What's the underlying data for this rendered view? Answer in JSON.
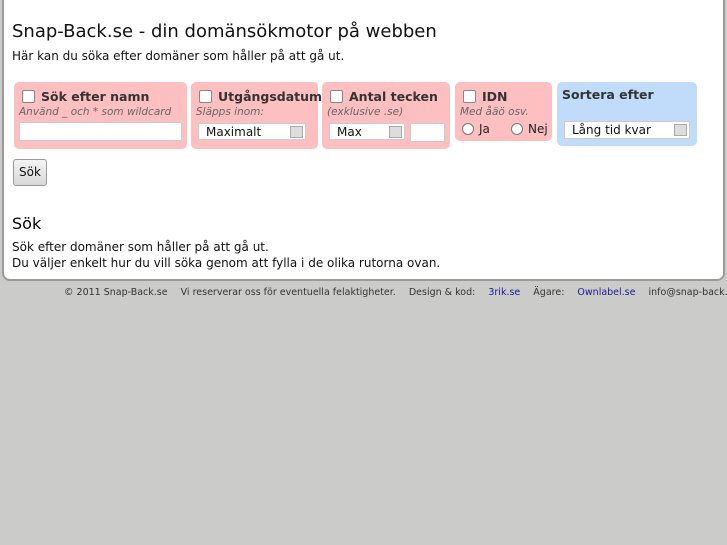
{
  "header": {
    "title": "Snap-Back.se - din domänsökmotor på webben",
    "subtitle": "Här kan du söka efter domäner som håller på att gå ut."
  },
  "filters": {
    "name": {
      "label": "Sök efter namn",
      "hint": "Använd _ och * som wildcard",
      "value": ""
    },
    "expiry": {
      "label": "Utgångsdatum",
      "hint": "Släpps inom:",
      "select": "Maximalt"
    },
    "length": {
      "label": "Antal tecken",
      "hint": "(exklusive .se)",
      "select": "Max",
      "value": ""
    },
    "idn": {
      "label": "IDN",
      "hint": "Med åäö osv.",
      "yes": "Ja",
      "no": "Nej"
    },
    "sort": {
      "label": "Sortera efter",
      "select": "Lång tid kvar"
    }
  },
  "search_button": "Sök",
  "info": {
    "title": "Sök",
    "line1": "Sök efter domäner som håller på att gå ut.",
    "line2": "Du väljer enkelt hur du vill söka genom att fylla i de olika rutorna ovan."
  },
  "footer": {
    "copyright": "© 2011 Snap-Back.se",
    "disclaimer": "Vi reserverar oss för eventuella felaktigheter.",
    "design_label": "Design & kod:",
    "design_link": "3rik.se",
    "owner_label": "Ägare:",
    "owner_link": "Ownlabel.se",
    "email": "info@snap-back.se"
  }
}
